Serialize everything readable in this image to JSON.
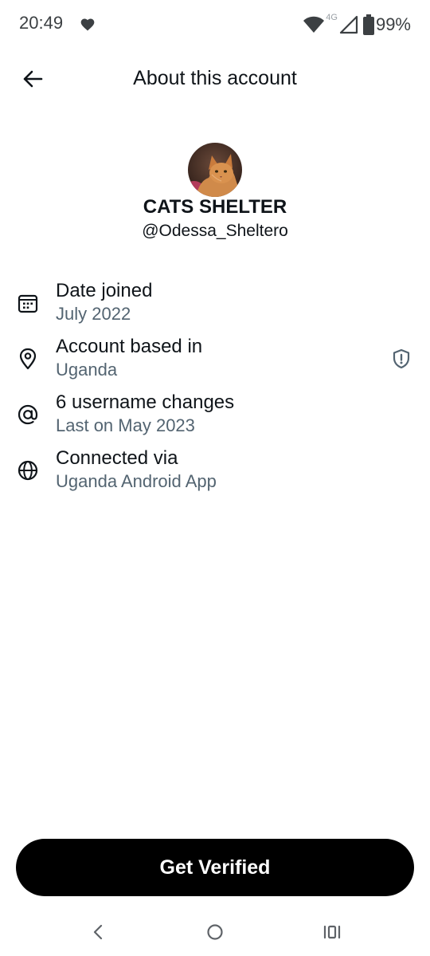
{
  "status_bar": {
    "time": "20:49",
    "network_label": "4G",
    "battery": "99%"
  },
  "header": {
    "title": "About this account",
    "back_icon": "arrow-left-icon"
  },
  "profile": {
    "display_name": "CATS SHELTER",
    "handle": "@Odessa_Sheltero",
    "avatar": "orange cat photo"
  },
  "info": [
    {
      "icon": "calendar-icon",
      "label": "Date joined",
      "value": "July 2022"
    },
    {
      "icon": "location-pin-icon",
      "label": "Account based in",
      "value": "Uganda",
      "aux_icon": "shield-alert-icon"
    },
    {
      "icon": "at-sign-icon",
      "label": "6 username changes",
      "value": "Last on May 2023"
    },
    {
      "icon": "globe-icon",
      "label": "Connected via",
      "value": "Uganda Android App"
    }
  ],
  "actions": {
    "verify_label": "Get Verified"
  },
  "colors": {
    "text_primary": "#0f1419",
    "text_secondary": "#536471",
    "button_bg": "#000000",
    "button_text": "#ffffff"
  }
}
